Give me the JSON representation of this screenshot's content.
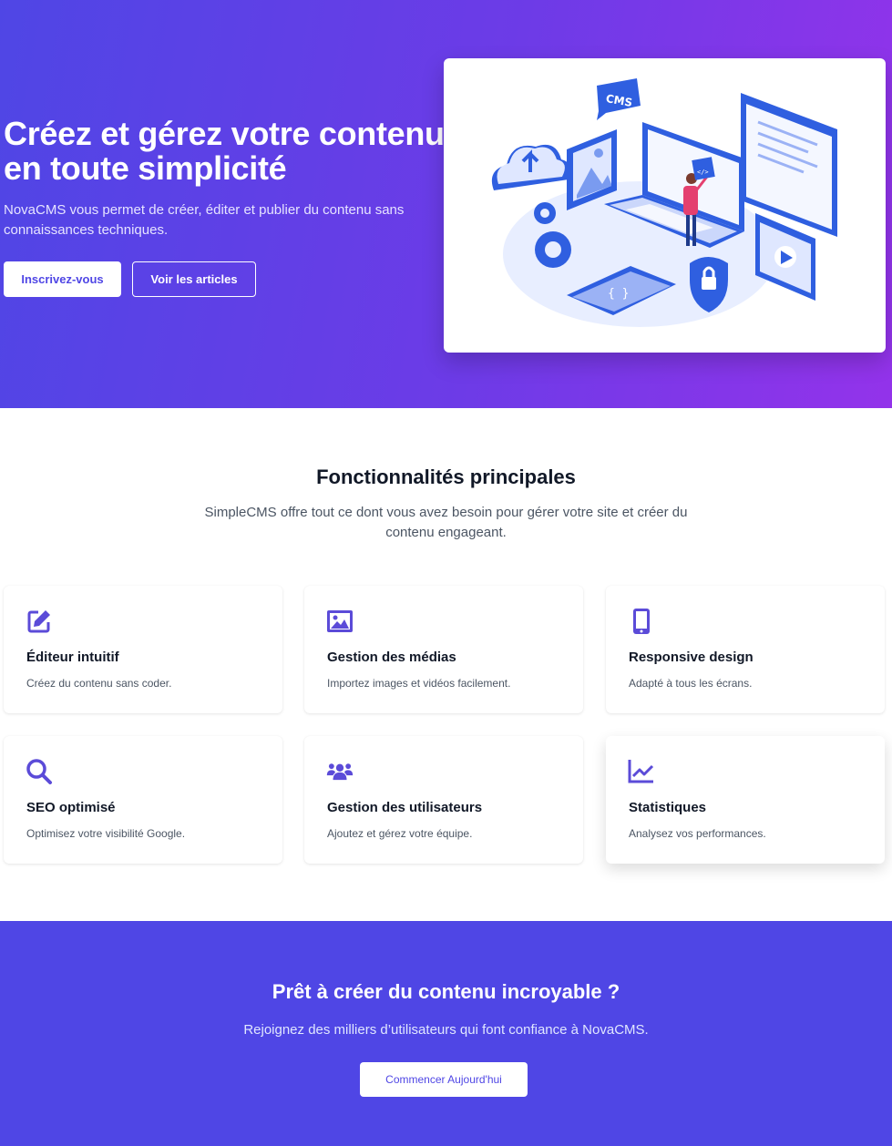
{
  "hero": {
    "title": "Créez et gérez votre contenu en toute simplicité",
    "subtitle": "NovaCMS vous permet de créer, éditer et publier du contenu sans connaissances techniques.",
    "primary_button": "Inscrivez-vous",
    "secondary_button": "Voir les articles",
    "illustration_label": "CMS"
  },
  "features": {
    "title": "Fonctionnalités principales",
    "subtitle": "SimpleCMS offre tout ce dont vous avez besoin pour gérer votre site et créer du contenu engageant.",
    "items": [
      {
        "icon": "edit-icon",
        "title": "Éditeur intuitif",
        "description": "Créez du contenu sans coder."
      },
      {
        "icon": "image-icon",
        "title": "Gestion des médias",
        "description": "Importez images et vidéos facilement."
      },
      {
        "icon": "mobile-icon",
        "title": "Responsive design",
        "description": "Adapté à tous les écrans."
      },
      {
        "icon": "search-icon",
        "title": "SEO optimisé",
        "description": "Optimisez votre visibilité Google."
      },
      {
        "icon": "users-icon",
        "title": "Gestion des utilisateurs",
        "description": "Ajoutez et gérez votre équipe."
      },
      {
        "icon": "chart-line-icon",
        "title": "Statistiques",
        "description": "Analysez vos performances."
      }
    ]
  },
  "cta": {
    "title": "Prêt à créer du contenu incroyable ?",
    "subtitle": "Rejoignez des milliers d’utilisateurs qui font confiance à NovaCMS.",
    "button": "Commencer Aujourd'hui"
  },
  "colors": {
    "accent": "#4f46e5",
    "gradient_end": "#9333ea",
    "icon": "#5b4bd8"
  }
}
